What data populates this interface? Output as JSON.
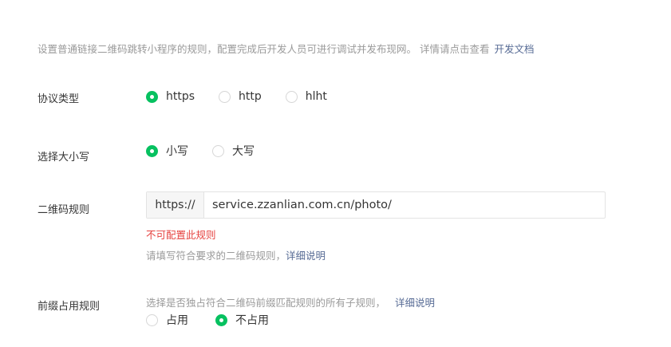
{
  "description": {
    "text": "设置普通链接二维码跳转小程序的规则，配置完成后开发人员可进行调试并发布现网。 详情请点击查看",
    "link": "开发文档"
  },
  "protocol": {
    "label": "协议类型",
    "options": [
      "https",
      "http",
      "hlht"
    ],
    "selected": "https"
  },
  "case": {
    "label": "选择大小写",
    "options": [
      "小写",
      "大写"
    ],
    "selected": "小写"
  },
  "qr_rule": {
    "label": "二维码规则",
    "prefix": "https://",
    "value": "service.zzanlian.com.cn/photo/",
    "error": "不可配置此规则",
    "tip": "请填写符合要求的二维码规则，",
    "tip_link": "详细说明"
  },
  "prefix_occupy": {
    "label": "前缀占用规则",
    "tip": "选择是否独占符合二维码前缀匹配规则的所有子规则，",
    "tip_link": "详细说明",
    "options": [
      "占用",
      "不占用"
    ],
    "selected": "不占用"
  },
  "colors": {
    "accent": "#07c160",
    "link": "#576b95",
    "error": "#e64340",
    "muted": "#9a9a9a"
  }
}
